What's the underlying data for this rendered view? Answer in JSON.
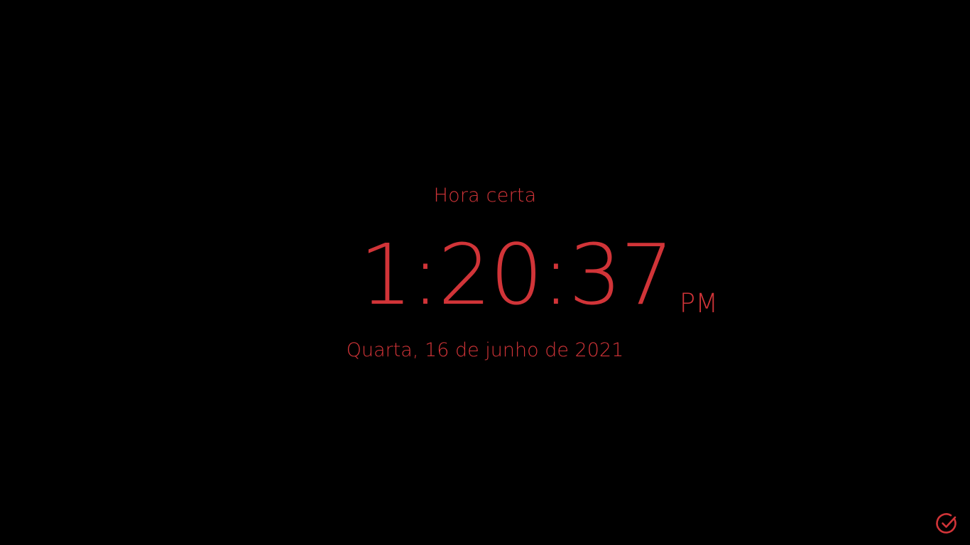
{
  "clock": {
    "title": "Hora certa",
    "time": "1:20:37",
    "ampm": "PM",
    "date": "Quarta, 16 de junho de 2021"
  },
  "controls": {
    "status_icon": "check-circle-icon"
  },
  "colors": {
    "background": "#000000",
    "accent": "#d13438"
  }
}
